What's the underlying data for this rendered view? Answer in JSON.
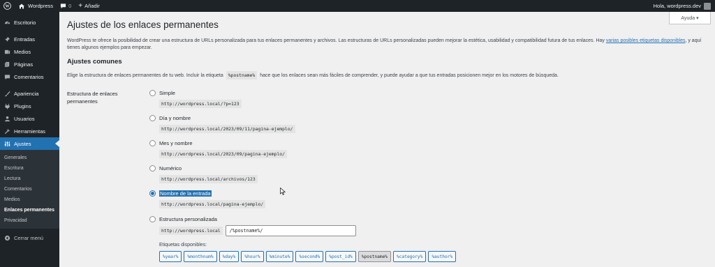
{
  "adminbar": {
    "site_name": "Wordpress",
    "comments_count": "0",
    "new_label": "Añadir",
    "greeting": "Hola, wordpress.dev"
  },
  "sidebar": {
    "items": [
      {
        "label": "Escritorio",
        "icon": "dashboard-icon"
      },
      {
        "label": "Entradas",
        "icon": "pin-icon"
      },
      {
        "label": "Medios",
        "icon": "media-icon"
      },
      {
        "label": "Páginas",
        "icon": "pages-icon"
      },
      {
        "label": "Comentarios",
        "icon": "comments-icon"
      },
      {
        "label": "Apariencia",
        "icon": "brush-icon"
      },
      {
        "label": "Plugins",
        "icon": "plugin-icon"
      },
      {
        "label": "Usuarios",
        "icon": "users-icon"
      },
      {
        "label": "Herramientas",
        "icon": "wrench-icon"
      },
      {
        "label": "Ajustes",
        "icon": "settings-icon"
      }
    ],
    "submenu": [
      "Generales",
      "Escritura",
      "Lectura",
      "Comentarios",
      "Medios",
      "Enlaces permanentes",
      "Privacidad"
    ],
    "collapse_label": "Cerrar menú"
  },
  "help_tab": "Ayuda ▾",
  "page": {
    "title": "Ajustes de los enlaces permanentes",
    "intro_before": "WordPress te ofrece la posibilidad de crear una estructura de URLs personalizada para tus enlaces permanentes y archivos. Las estructuras de URLs personalizadas pueden mejorar la estética, usabilidad y compatibilidad futura de tus enlaces. Hay ",
    "intro_link": "varias posibles etiquetas disponibles",
    "intro_after": ", y aquí tienes algunos ejemplos para empezar.",
    "section_title": "Ajustes comunes",
    "section_desc_before": "Elige la estructura de enlaces permanentes de tu web. Incluir la etiqueta",
    "section_desc_code": "%postname%",
    "section_desc_after": "hace que los enlaces sean más fáciles de comprender, y puede ayudar a que tus entradas posicionen mejor en los motores de búsqueda.",
    "row_label": "Estructura de enlaces permanentes"
  },
  "options": [
    {
      "label": "Simple",
      "example": "http://wordpress.local/?p=123",
      "checked": false
    },
    {
      "label": "Día y nombre",
      "example": "http://wordpress.local/2023/09/11/pagina-ejemplo/",
      "checked": false
    },
    {
      "label": "Mes y nombre",
      "example": "http://wordpress.local/2023/09/pagina-ejemplo/",
      "checked": false
    },
    {
      "label": "Numérico",
      "example": "http://wordpress.local/archivos/123",
      "checked": false
    },
    {
      "label": "Nombre de la entrada",
      "example": "http://wordpress.local/pagina-ejemplo/",
      "checked": true
    }
  ],
  "custom": {
    "label": "Estructura personalizada",
    "prefix": "http://wordpress.local",
    "value": "/%postname%/",
    "tags_label": "Etiquetas disponibles:",
    "tags": [
      "%year%",
      "%monthnum%",
      "%day%",
      "%hour%",
      "%minute%",
      "%second%",
      "%post_id%",
      "%postname%",
      "%category%",
      "%author%"
    ],
    "active_tag": "%postname%"
  },
  "colors": {
    "accent": "#2271b1",
    "adminbar": "#1d2327",
    "background": "#f0f0f1"
  }
}
